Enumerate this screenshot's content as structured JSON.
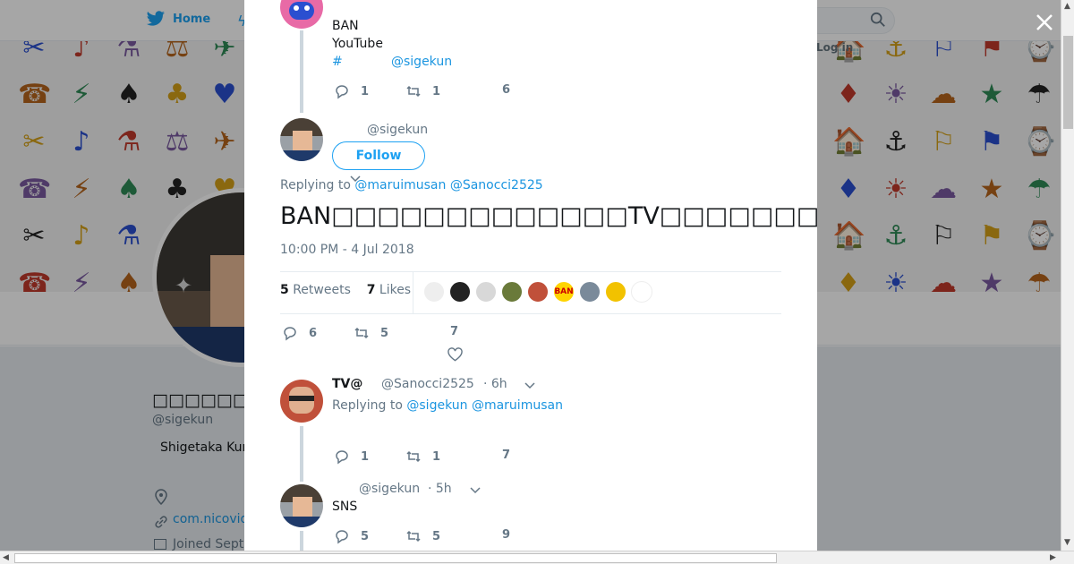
{
  "nav": {
    "home_label": "Home",
    "login_label": "Log in"
  },
  "background_profile": {
    "name": "□□□□□□□□□□",
    "handle": "@sigekun",
    "bio": "Shigetaka Kur",
    "link": "com.nicovid",
    "joined": "Joined Septe"
  },
  "banner_glyphs": [
    "✂",
    "♪",
    "⚗",
    "⚖",
    "✈",
    "🏠",
    "⚓",
    "⚐",
    "⚑",
    "⌚",
    "☎",
    "⚡",
    "♠",
    "♣",
    "♥",
    "♦",
    "☀",
    "☁",
    "★",
    "☂"
  ],
  "modal": {
    "prev_tweet": {
      "lines": [
        "BAN",
        "YouTube"
      ],
      "hashtag": "#",
      "mention": "@sigekun",
      "replies": "1",
      "retweets": "1",
      "likes": "6"
    },
    "main_tweet": {
      "handle": "@sigekun",
      "follow_label": "Follow",
      "replying_prefix": "Replying to",
      "reply_to_1": "@maruimusan",
      "reply_to_2": "@Sanocci2525",
      "text": "BAN□□□□□□□□□□□□□TV□□□□□□□□□□□□TV□□□□□□□□□□□□□□□□□□□",
      "timestamp": "10:00 PM - 4 Jul 2018",
      "retweets_count": "5",
      "retweets_label": "Retweets",
      "likes_count": "7",
      "likes_label": "Likes",
      "replies": "6",
      "retweet_action": "5",
      "like_action": "7"
    },
    "reply_1": {
      "name": "TV@",
      "handle": "@Sanocci2525",
      "time": "· 6h",
      "replying_prefix": "Replying to",
      "reply_to_1": "@sigekun",
      "reply_to_2": "@maruimusan",
      "replies": "1",
      "retweets": "1",
      "likes": "7"
    },
    "reply_2": {
      "handle": "@sigekun",
      "time": "· 5h",
      "text": "SNS",
      "replies": "5",
      "retweets": "5",
      "likes": "9"
    }
  },
  "colors": {
    "accent": "#1da1f2",
    "link": "#1b95e0",
    "muted": "#657786",
    "thread": "#ccd6dd"
  }
}
